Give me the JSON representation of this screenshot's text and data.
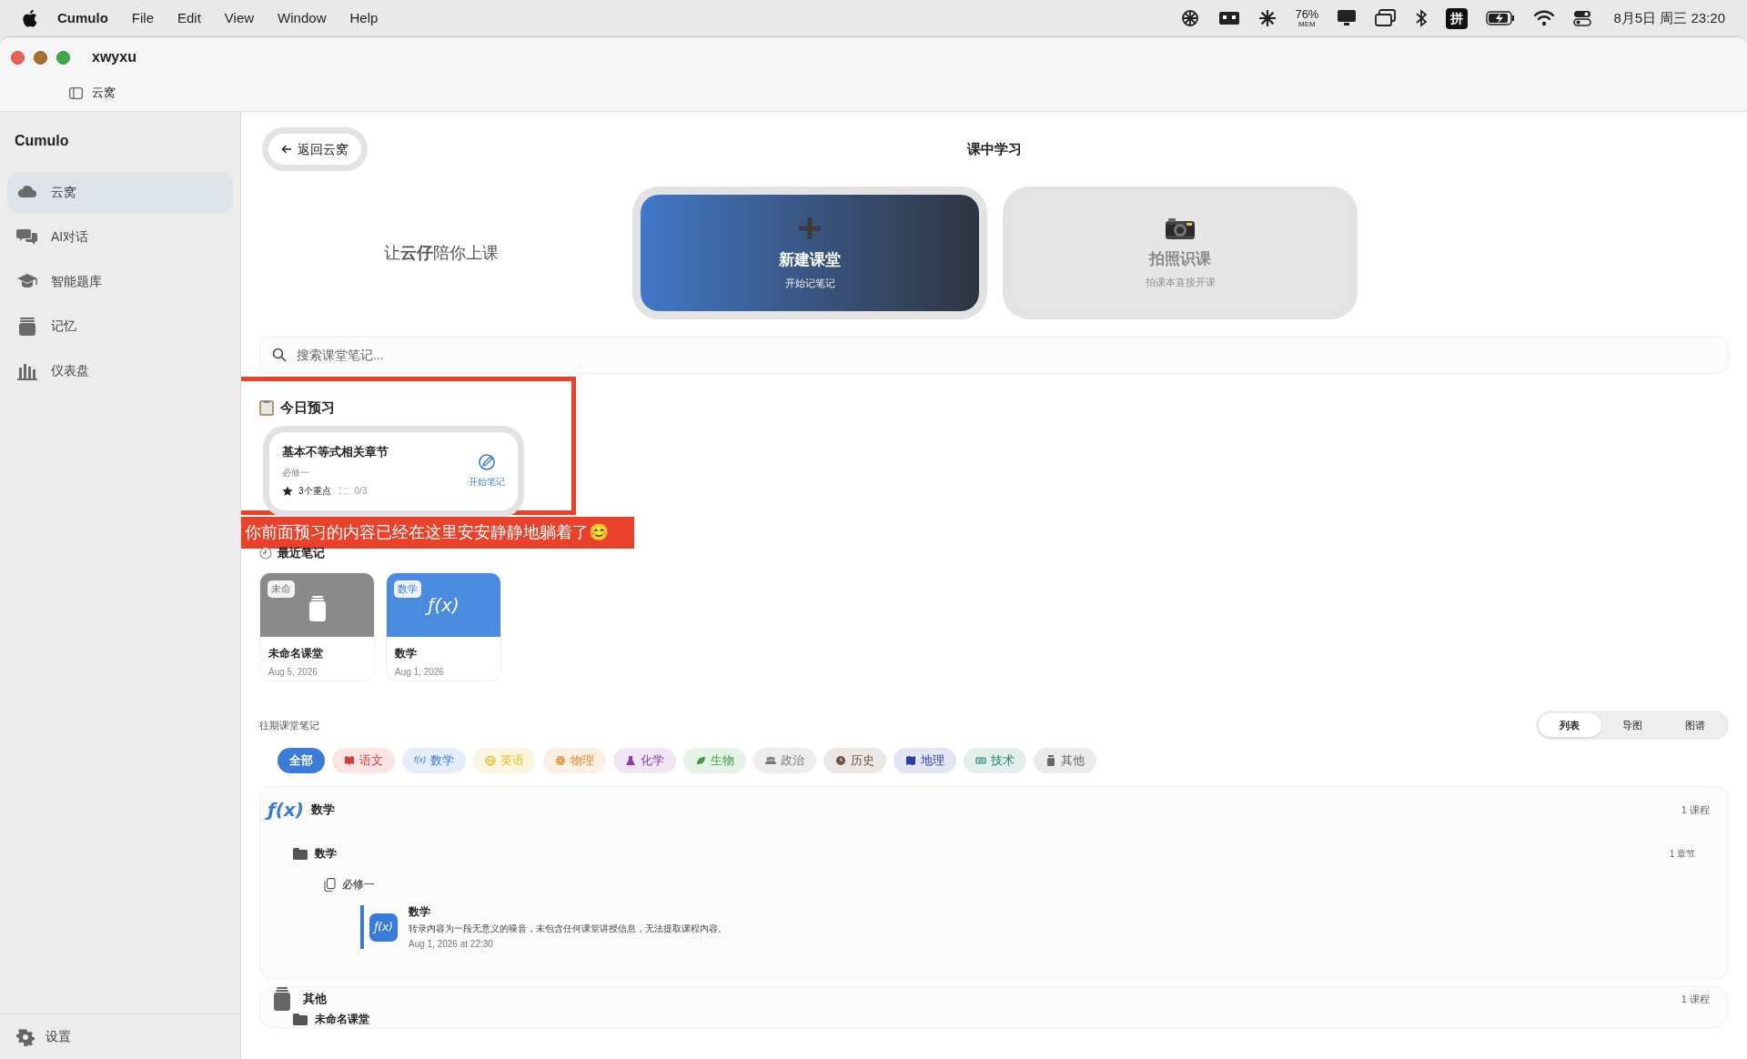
{
  "menu_bar": {
    "app": "Cumulo",
    "menus": [
      "File",
      "Edit",
      "View",
      "Window",
      "Help"
    ],
    "memory": {
      "percent": "76%",
      "label": "MEM"
    },
    "input_method": "拼",
    "clock": "8月5日 周三 23:20"
  },
  "window": {
    "title": "xwyxu",
    "breadcrumb": "云窝"
  },
  "sidebar": {
    "title": "Cumulo",
    "items": [
      {
        "label": "云窝",
        "selected": true
      },
      {
        "label": "AI对话",
        "selected": false
      },
      {
        "label": "智能题库",
        "selected": false
      },
      {
        "label": "记忆",
        "selected": false
      },
      {
        "label": "仪表盘",
        "selected": false
      }
    ],
    "footer": "设置"
  },
  "header": {
    "back": "返回云窝",
    "title": "课中学习"
  },
  "hero": {
    "tagline": "让**云仔**陪你上课",
    "actions": [
      {
        "title": "新建课堂",
        "subtitle": "开始记笔记",
        "disabled": false
      },
      {
        "title": "拍照识课",
        "subtitle": "拍课本直接开课",
        "disabled": true
      }
    ]
  },
  "search": {
    "placeholder": "搜索课堂笔记..."
  },
  "today": {
    "title": "今日预习",
    "items": [
      {
        "title": "基本不等式相关章节",
        "course": "必修一",
        "highlights": "3个重点",
        "progress": "0/3",
        "action": "开始笔记"
      }
    ]
  },
  "annotation": "你前面预习的内容已经在这里安安静静地躺着了😊",
  "recent": {
    "title": "最近笔记",
    "notes": [
      {
        "badge": "未命",
        "title": "未命名课堂",
        "date": "Aug 5, 2026",
        "color": "#8a8a8a"
      },
      {
        "badge": "数学",
        "cover_text": "ƒ(x)",
        "title": "数学",
        "date": "Aug 1, 2026",
        "color": "#4a8be0"
      }
    ]
  },
  "archive": {
    "title": "往期课堂笔记",
    "views": [
      {
        "label": "列表",
        "selected": true
      },
      {
        "label": "导图",
        "selected": false
      },
      {
        "label": "图谱",
        "selected": false
      }
    ],
    "filters": [
      {
        "label": "全部",
        "selected": true,
        "color": "#3b7bd8"
      },
      {
        "label": "语文",
        "selected": false,
        "color": "#d63a34"
      },
      {
        "label": "数学",
        "selected": false,
        "color": "#3b7bd8",
        "icon_text": "f(x)"
      },
      {
        "label": "英语",
        "selected": false,
        "color": "#e3bd1c"
      },
      {
        "label": "物理",
        "selected": false,
        "color": "#e8892a"
      },
      {
        "label": "化学",
        "selected": false,
        "color": "#8e3aa8"
      },
      {
        "label": "生物",
        "selected": false,
        "color": "#3c9a45"
      },
      {
        "label": "政治",
        "selected": false,
        "color": "#7a7a7a"
      },
      {
        "label": "历史",
        "selected": false,
        "color": "#6d5145"
      },
      {
        "label": "地理",
        "selected": false,
        "color": "#2d3b9e"
      },
      {
        "label": "技术",
        "selected": false,
        "color": "#1f7f6f"
      },
      {
        "label": "其他",
        "selected": false,
        "color": "#666666"
      }
    ],
    "groups": [
      {
        "icon_text": "ƒ(x)",
        "name": "数学",
        "count": "1 课程",
        "children": [
          {
            "name": "数学",
            "count": "1 章节",
            "children": [
              {
                "name": "必修一",
                "notes": [
                  {
                    "icon_text": "ƒ(x)",
                    "title": "数学",
                    "summary": "转录内容为一段无意义的噪音，未包含任何课堂讲授信息，无法提取课程内容。",
                    "time": "Aug 1, 2026 at 22:30"
                  }
                ]
              }
            ]
          }
        ]
      },
      {
        "name": "其他",
        "count": "1 课程",
        "children": [
          {
            "name": "未命名课堂"
          }
        ]
      }
    ]
  }
}
